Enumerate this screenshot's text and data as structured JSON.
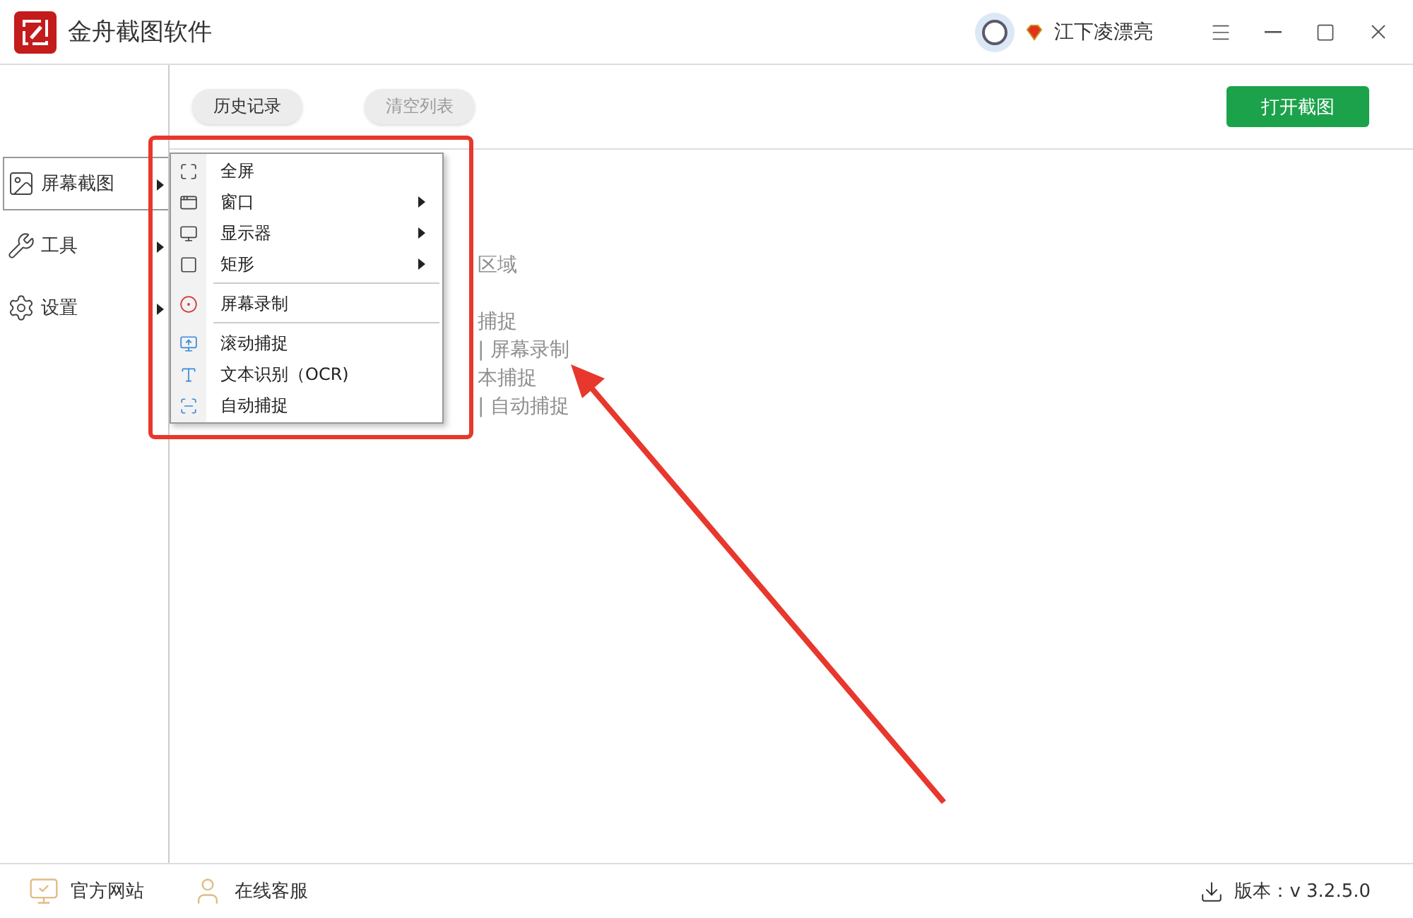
{
  "window": {
    "title": "金舟截图软件"
  },
  "user": {
    "name": "江下凌漂亮"
  },
  "toolbar": {
    "buttons": [
      {
        "label": "历史记录",
        "disabled": false
      },
      {
        "label": "清空列表",
        "disabled": true
      }
    ],
    "primary": {
      "label": "打开截图"
    }
  },
  "sidebar": {
    "items": [
      {
        "label": "屏幕截图",
        "selected": true
      },
      {
        "label": "工具",
        "selected": false
      },
      {
        "label": "设置",
        "selected": false
      }
    ]
  },
  "menu": {
    "groups": [
      [
        {
          "label": "全屏",
          "has_submenu": false
        },
        {
          "label": "窗口",
          "has_submenu": true
        },
        {
          "label": "显示器",
          "has_submenu": true
        },
        {
          "label": "矩形",
          "has_submenu": true
        }
      ],
      [
        {
          "label": "屏幕录制",
          "has_submenu": false
        }
      ],
      [
        {
          "label": "滚动捕捉",
          "has_submenu": false
        },
        {
          "label": "文本识别（OCR)",
          "has_submenu": false
        },
        {
          "label": "自动捕捉",
          "has_submenu": false
        }
      ]
    ]
  },
  "background_text": [
    "区域",
    "捕捉",
    "| 屏幕录制",
    "本捕捉",
    "| 自动捕捉"
  ],
  "footer": {
    "links": [
      "官方网站",
      "在线客服"
    ],
    "version": "版本：v 3.2.5.0"
  }
}
